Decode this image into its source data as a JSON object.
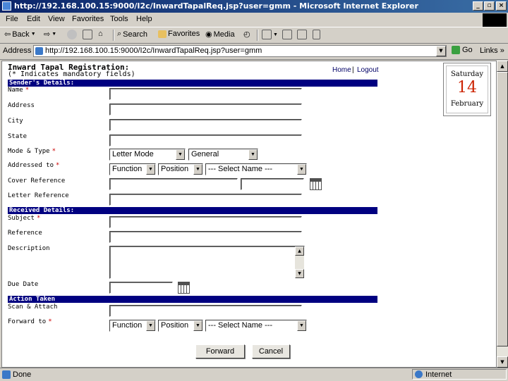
{
  "window": {
    "title": "http://192.168.100.15:9000/I2c/InwardTapalReq.jsp?user=gmm - Microsoft Internet Explorer",
    "controls": [
      "_",
      "▫",
      "×"
    ]
  },
  "menu": [
    "File",
    "Edit",
    "View",
    "Favorites",
    "Tools",
    "Help"
  ],
  "toolbar": {
    "back": "Back",
    "search": "Search",
    "favorites": "Favorites",
    "media": "Media"
  },
  "address": {
    "label": "Address",
    "url": "http://192.168.100.15:9000/I2c/InwardTapalReq.jsp?user=gmm",
    "go": "Go",
    "links": "Links"
  },
  "page": {
    "title": "Inward Tapal Registration:",
    "note": "(* Indicates mandatory fields)",
    "home": "Home",
    "divider": "|",
    "logout": "Logout"
  },
  "date": {
    "day_name": "Saturday",
    "day": "14",
    "month": "February"
  },
  "sections": {
    "sender": "Sender's Details:",
    "received": "Received Details:",
    "action": "Action Taken"
  },
  "labels": {
    "name": "Name",
    "address": "Address",
    "city": "City",
    "state": "State",
    "mode_type": "Mode & Type",
    "addressed_to": "Addressed to",
    "cover_reference": "Cover Reference",
    "letter_reference": "Letter Reference",
    "subject": "Subject",
    "reference": "Reference",
    "description": "Description",
    "due_date": "Due Date",
    "scan_attach": "Scan & Attach",
    "forward_to": "Forward to",
    "required": "*"
  },
  "selects": {
    "mode": "Letter Mode",
    "type": "General",
    "addr_function": "Function",
    "addr_position": "Position",
    "addr_name": "--- Select Name ---",
    "fwd_function": "Function",
    "fwd_position": "Position",
    "fwd_name": "--- Select Name ---"
  },
  "buttons": {
    "forward": "Forward",
    "cancel": "Cancel"
  },
  "status": {
    "text": "Done",
    "zone": "Internet"
  },
  "colors": {
    "section_bar": "#000080",
    "title_bar": "#0a246a",
    "required": "#cc0000",
    "date_number": "#cc2200"
  }
}
